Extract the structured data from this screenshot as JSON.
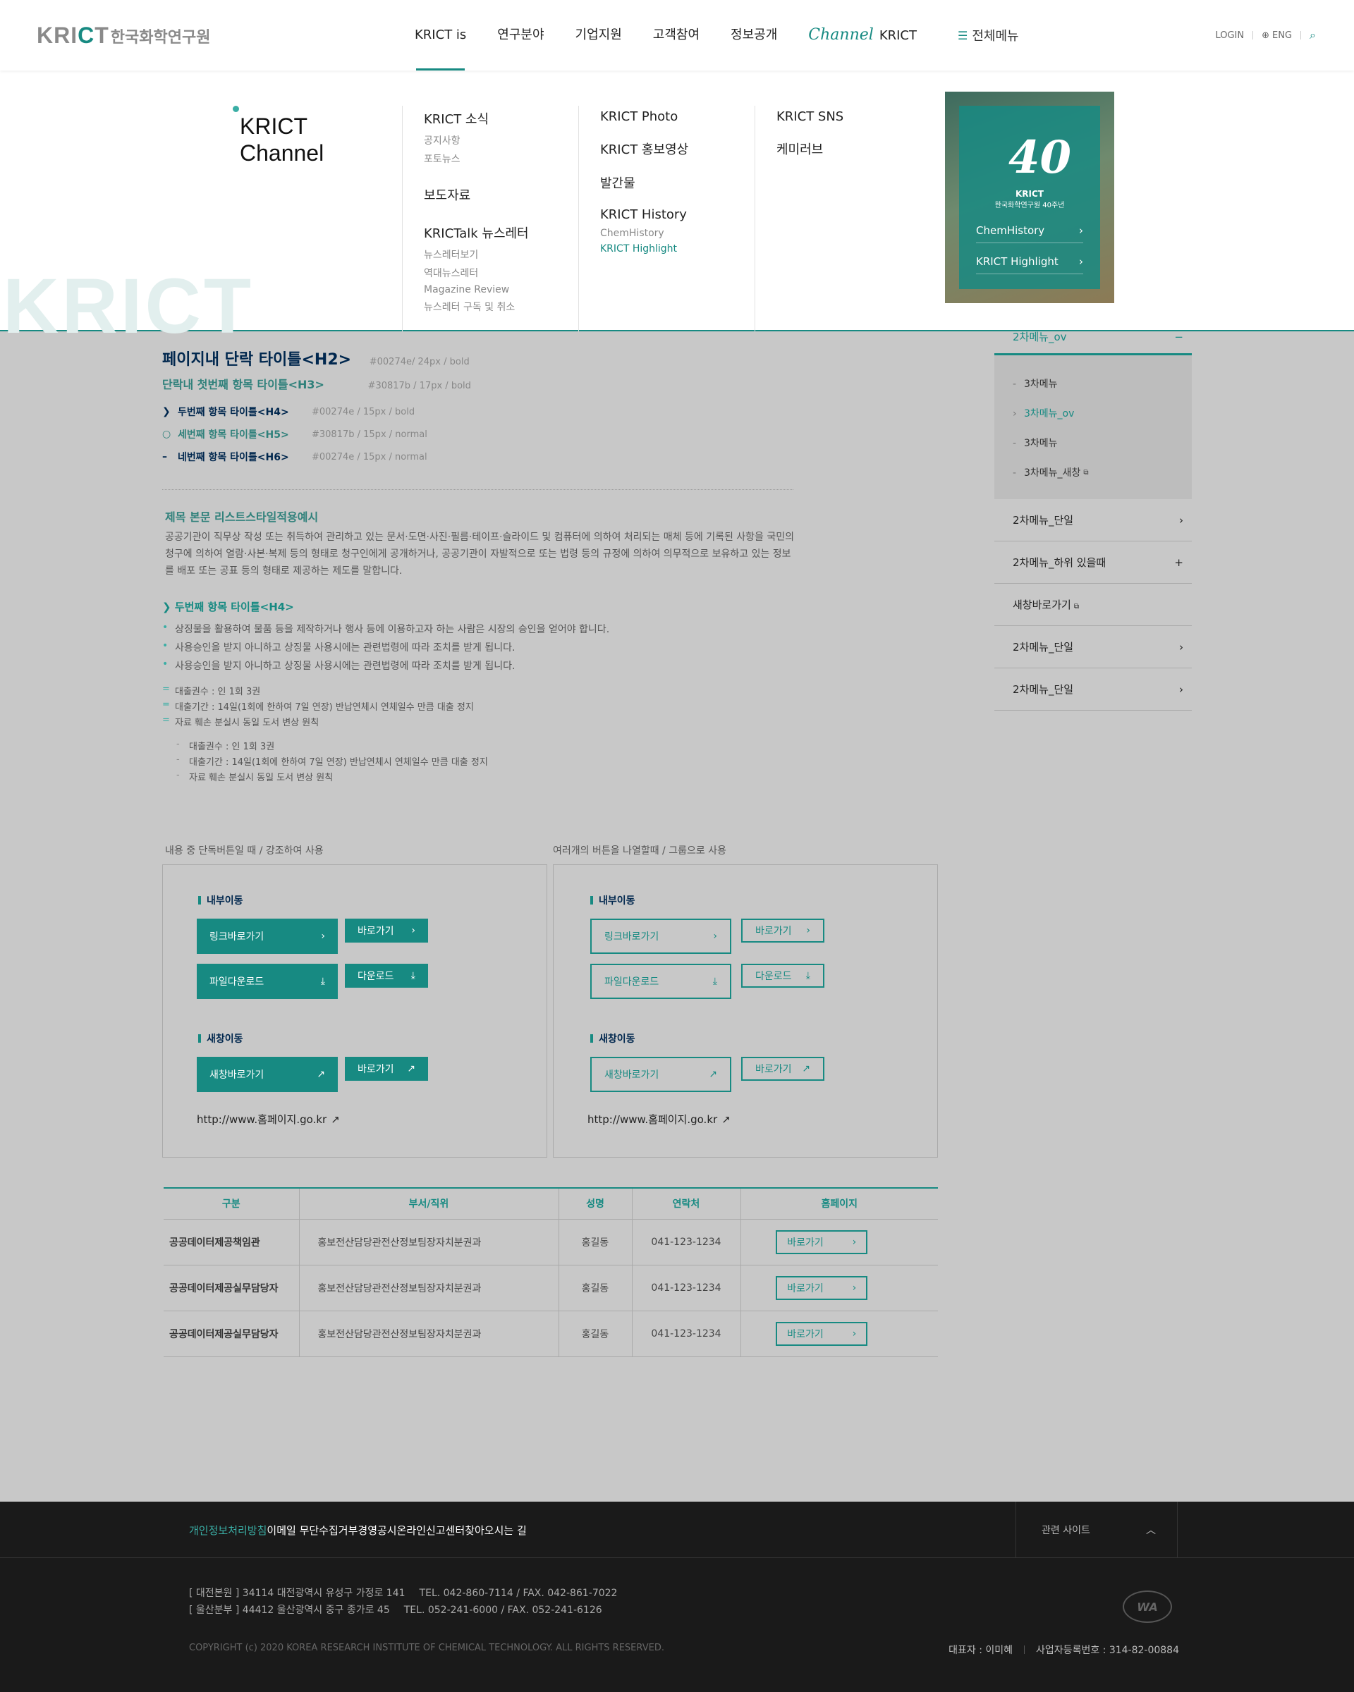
{
  "header": {
    "logo_en_a": "KRI",
    "logo_en_c": "C",
    "logo_en_b": "T",
    "logo_ko": "한국화학연구원",
    "nav": [
      "KRICT is",
      "연구분야",
      "기업지원",
      "고객참여",
      "정보공개"
    ],
    "channel_script": "Channel",
    "channel_text": "KRICT",
    "all_menu": "전체메뉴",
    "login": "LOGIN",
    "lang": "ENG"
  },
  "mega": {
    "title_line1": "KRICT",
    "title_line2": "Channel",
    "watermark_a": "KRI",
    "watermark_c": "C",
    "watermark_b": "T",
    "col1": {
      "news": "KRICT 소식",
      "news_subs": [
        "공지사항",
        "포토뉴스"
      ],
      "press": "보도자료",
      "newsletter": "KRICTalk 뉴스레터",
      "newsletter_subs": [
        "뉴스레터보기",
        "역대뉴스레터",
        "Magazine Review",
        "뉴스레터 구독 및 취소"
      ]
    },
    "col2": {
      "items": [
        "KRICT Photo",
        "KRICT 홍보영상",
        "발간물",
        "KRICT History"
      ],
      "subs": [
        "ChemHistory",
        "KRICT Highlight"
      ]
    },
    "col3": {
      "items": [
        "KRICT SNS",
        "케미러브"
      ]
    },
    "banner": {
      "big": "40",
      "brand": "KRICT",
      "caption": "한국화학연구원 40주년",
      "link1": "ChemHistory",
      "link2": "KRICT Highlight"
    }
  },
  "typography": {
    "h2": "페이지내 단락 타이틀<H2>",
    "h2_spec": "#00274e/ 24px / bold",
    "h3": "단락내 첫번째 항목 타이틀<H3>",
    "h3_spec": "#30817b / 17px / bold",
    "h4": "두번째 항목 타이틀<H4>",
    "h4_spec": "#00274e / 15px / bold",
    "h5": "세번째 항목 타이틀<H5>",
    "h5_spec": "#30817b / 15px / normal",
    "h6": "네번째 항목 타이틀<H6>",
    "h6_spec": "#00274e / 15px / normal"
  },
  "body": {
    "list_title": "제목 본문 리스트스타일적용예시",
    "paragraph": "공공기관이 직무상 작성 또는 취득하여 관리하고 있는 문서·도면·사진·필름·테이프·슬라이드 및 컴퓨터에 의하여 처리되는 매체 등에 기록된 사항을 국민의 청구에 의하여 열람·사본·복제 등의 형태로 청구인에게 공개하거나, 공공기관이 자발적으로 또는 법령 등의 규정에 의하여 의무적으로 보유하고 있는 정보를 배포 또는 공표 등의 형태로 제공하는 제도를 말합니다.",
    "h4_title": "두번째 항목 타이틀<H4>",
    "dots": [
      "상징물을 활용하여 물품 등을 제작하거나 행사 등에 이용하고자 하는 사람은 시장의 승인을 얻어야 합니다.",
      "사용승인을 받지 아니하고 상징물 사용시에는 관련법령에 따라 조치를 받게 됩니다.",
      "사용승인을 받지 아니하고 상징물 사용시에는 관련법령에 따라 조치를 받게 됩니다."
    ],
    "eq_list": [
      "대출권수 : 인 1회 3권",
      "대출기간 : 14일(1회에 한하여 7일 연장) 반납연체시 연체일수 만큼 대출 정지",
      "자료 훼손 분실시 동일 도서 변상 원칙"
    ],
    "dash_list": [
      "대출권수 : 인 1회 3권",
      "대출기간 : 14일(1회에 한하여 7일 연장) 반납연체시 연체일수 만큼 대출 정지",
      "자료 훼손 분실시 동일 도서 변상 원칙"
    ]
  },
  "snb": {
    "current": "2차메뉴_ov",
    "sub3": [
      "3차메뉴",
      "3차메뉴_ov",
      "3차메뉴",
      "3차메뉴_새창"
    ],
    "rows": [
      "2차메뉴_단일",
      "2차메뉴_하위 있을때",
      "새창바로가기",
      "2차메뉴_단일",
      "2차메뉴_단일"
    ]
  },
  "buttons": {
    "cap_left": "내용 중 단독버튼일 때 / 강조하여 사용",
    "cap_right": "여러개의 버튼을 나열할때 / 그룹으로 사용",
    "internal": "내부이동",
    "newwin": "새창이동",
    "link_go": "링크바로가기",
    "go": "바로가기",
    "file_down": "파일다운로드",
    "down": "다운로드",
    "new_go": "새창바로가기",
    "url": "http://www.홈페이지.go.kr"
  },
  "table": {
    "headers": [
      "구분",
      "부서/직위",
      "성명",
      "연락처",
      "홈페이지"
    ],
    "rows": [
      [
        "공공데이터제공책임관",
        "홍보전산담당관전산정보팀장자치분권과",
        "홍길동",
        "041-123-1234",
        "바로가기"
      ],
      [
        "공공데이터제공실무담당자",
        "홍보전산담당관전산정보팀장자치분권과",
        "홍길동",
        "041-123-1234",
        "바로가기"
      ],
      [
        "공공데이터제공실무담당자",
        "홍보전산담당관전산정보팀장자치분권과",
        "홍길동",
        "041-123-1234",
        "바로가기"
      ]
    ]
  },
  "footer": {
    "links": [
      "개인정보처리방침",
      "이메일 무단수집거부",
      "경영공시",
      "온라인신고센터",
      "찾아오시는 길"
    ],
    "related": "관련 사이트",
    "addr1": "[ 대전본원 ] 34114  대전광역시 유성구 가정로 141",
    "tel1": "TEL. 042-860-7114 / FAX. 042-861-7022",
    "addr2": "[ 울산분부 ] 44412  울산광역시 중구 종가로 45",
    "tel2": "TEL. 052-241-6000 / FAX. 052-241-6126",
    "copyright": "COPYRIGHT (c) 2020 KOREA RESEARCH INSTITUTE OF CHEMICAL TECHNOLOGY. ALL RIGHTS RESERVED.",
    "rep": "대표자 : 이미혜",
    "biz": "사업자등록번호 : 314-82-00884",
    "wa": "WA"
  },
  "colors": {
    "accent": "#178a82",
    "h3": "#30817b",
    "navy": "#00274e",
    "footer": "#1a1a1a"
  }
}
